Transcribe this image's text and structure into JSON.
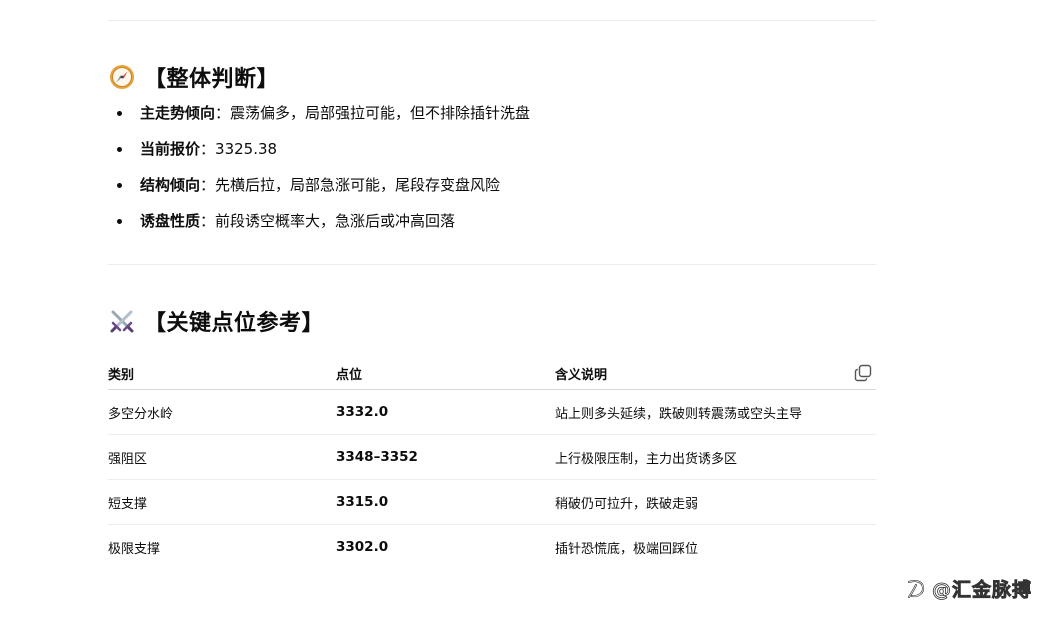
{
  "overall": {
    "icon": "compass-icon",
    "title": "【整体判断】",
    "items": [
      {
        "key": "主走势倾向",
        "sep": "：",
        "value": "震荡偏多，局部强拉可能，但不排除插针洗盘"
      },
      {
        "key": "当前报价",
        "sep": "：",
        "value": "3325.38"
      },
      {
        "key": "结构倾向",
        "sep": "：",
        "value": "先横后拉，局部急涨可能，尾段存变盘风险"
      },
      {
        "key": "诱盘性质",
        "sep": "：",
        "value": "前段诱空概率大，急涨后或冲高回落"
      }
    ]
  },
  "levels": {
    "icon": "crossed-swords-icon",
    "title": "【关键点位参考】",
    "table": {
      "headers": [
        "类别",
        "点位",
        "含义说明"
      ],
      "rows": [
        [
          "多空分水岭",
          "3332.0",
          "站上则多头延续，跌破则转震荡或空头主导"
        ],
        [
          "强阻区",
          "3348–3352",
          "上行极限压制，主力出货诱多区"
        ],
        [
          "短支撑",
          "3315.0",
          "稍破仍可拉升，跌破走弱"
        ],
        [
          "极限支撑",
          "3302.0",
          "插针恐慌底，极端回踩位"
        ]
      ]
    },
    "copy_icon": "copy-icon"
  },
  "watermark": {
    "icon": "zhihu-logo-icon",
    "text": "@汇金脉搏"
  }
}
